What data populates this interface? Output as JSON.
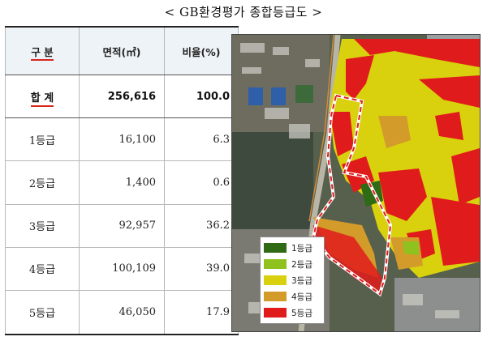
{
  "title": "< GB환경평가 종합등급도 >",
  "table": {
    "headers": [
      "구 분",
      "면적(㎡)",
      "비율(%)"
    ],
    "total": {
      "label": "합 계",
      "area": "256,616",
      "ratio": "100.0"
    },
    "rows": [
      {
        "label": "1등급",
        "area": "16,100",
        "ratio": "6.3"
      },
      {
        "label": "2등급",
        "area": "1,400",
        "ratio": "0.6"
      },
      {
        "label": "3등급",
        "area": "92,957",
        "ratio": "36.2"
      },
      {
        "label": "4등급",
        "area": "100,109",
        "ratio": "39.0"
      },
      {
        "label": "5등급",
        "area": "46,050",
        "ratio": "17.9"
      }
    ]
  },
  "legend": {
    "items": [
      {
        "label": "1등급",
        "color": "#2f6a14"
      },
      {
        "label": "2등급",
        "color": "#8fc21e"
      },
      {
        "label": "3등급",
        "color": "#d9d10e"
      },
      {
        "label": "4등급",
        "color": "#d39b2a"
      },
      {
        "label": "5등급",
        "color": "#e01b1b"
      }
    ]
  }
}
